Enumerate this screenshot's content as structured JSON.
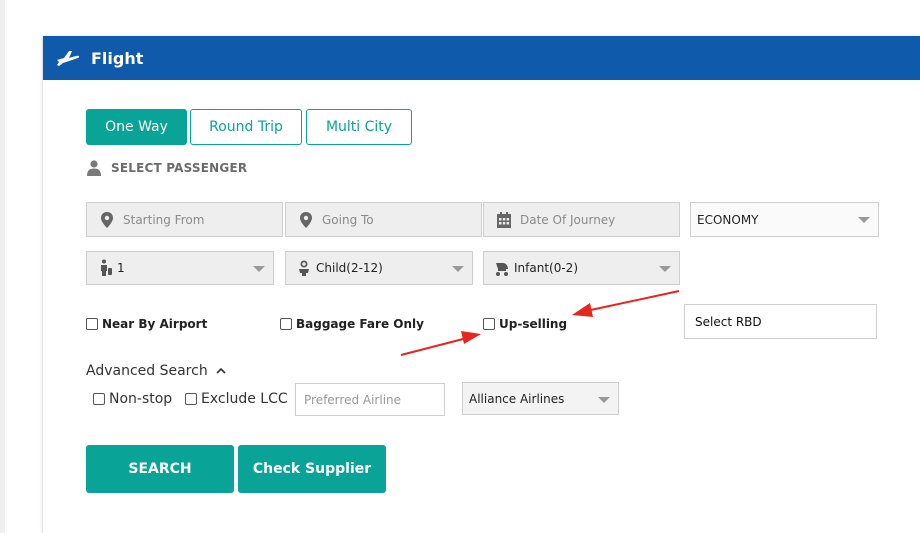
{
  "header": {
    "title": "Flight",
    "icon": "plane-icon"
  },
  "trip_types": [
    {
      "label": "One Way",
      "active": true
    },
    {
      "label": "Round Trip",
      "active": false
    },
    {
      "label": "Multi City",
      "active": false
    }
  ],
  "passenger": {
    "label": "SELECT PASSENGER",
    "icon": "user-icon"
  },
  "search_fields": {
    "from_placeholder": "Starting From",
    "to_placeholder": "Going To",
    "date_placeholder": "Date Of Journey",
    "cabin_class": "ECONOMY"
  },
  "travellers": {
    "adults": "1",
    "child": "Child(2-12)",
    "infant": "Infant(0-2)"
  },
  "options": {
    "near_by_airport": "Near By Airport",
    "baggage_fare_only": "Baggage Fare Only",
    "up_selling": "Up-selling",
    "select_rbd": "Select RBD"
  },
  "advanced": {
    "label": "Advanced Search",
    "non_stop": "Non-stop",
    "exclude_lcc": "Exclude LCC",
    "preferred_airline_placeholder": "Preferred Airline",
    "alliance": "Alliance Airlines"
  },
  "actions": {
    "search": "SEARCH",
    "check_supplier": "Check Supplier"
  },
  "colors": {
    "header": "#0f5aab",
    "accent": "#0aa397",
    "annotation_arrow": "#e8241e"
  }
}
